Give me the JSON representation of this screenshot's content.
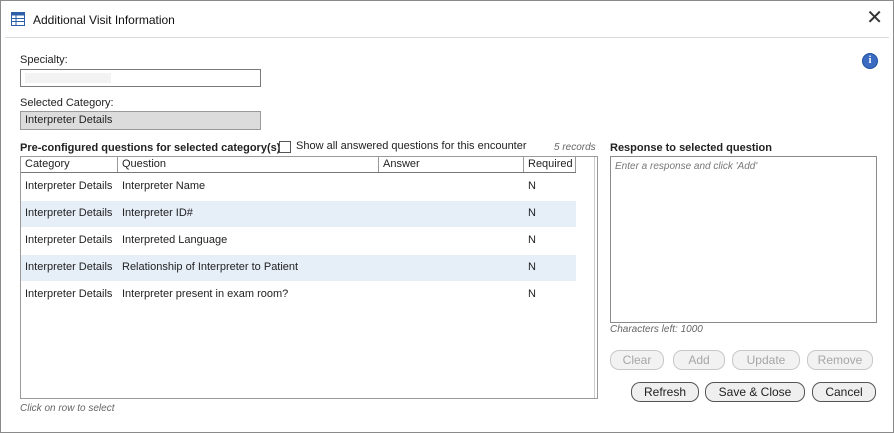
{
  "window": {
    "title": "Additional Visit Information"
  },
  "specialty": {
    "label": "Specialty:",
    "value": ""
  },
  "category": {
    "label": "Selected Category:",
    "value": "Interpreter Details"
  },
  "questions": {
    "heading": "Pre-configured questions for selected category(s)",
    "show_all_label": "Show all answered questions for this encounter",
    "show_all_checked": false,
    "record_count": "5 records",
    "columns": [
      "Category",
      "Question",
      "Answer",
      "Required"
    ],
    "rows": [
      {
        "category": "Interpreter Details",
        "question": "Interpreter Name",
        "answer": "",
        "required": "N"
      },
      {
        "category": "Interpreter Details",
        "question": "Interpreter ID#",
        "answer": "",
        "required": "N"
      },
      {
        "category": "Interpreter Details",
        "question": "Interpreted Language",
        "answer": "",
        "required": "N"
      },
      {
        "category": "Interpreter Details",
        "question": "Relationship of Interpreter to Patient",
        "answer": "",
        "required": "N"
      },
      {
        "category": "Interpreter Details",
        "question": "Interpreter present in exam room?",
        "answer": "",
        "required": "N"
      }
    ],
    "hint": "Click on row to select"
  },
  "response": {
    "heading": "Response to selected question",
    "placeholder": "Enter a response and click 'Add'",
    "chars_left": "Characters left: 1000"
  },
  "buttons": {
    "clear": "Clear",
    "add": "Add",
    "update": "Update",
    "remove": "Remove",
    "refresh": "Refresh",
    "save_close": "Save & Close",
    "cancel": "Cancel"
  },
  "colors": {
    "row_alt": "#e6eef8",
    "info_icon": "#3a6bc0",
    "readonly_field": "#dcdcdc"
  }
}
